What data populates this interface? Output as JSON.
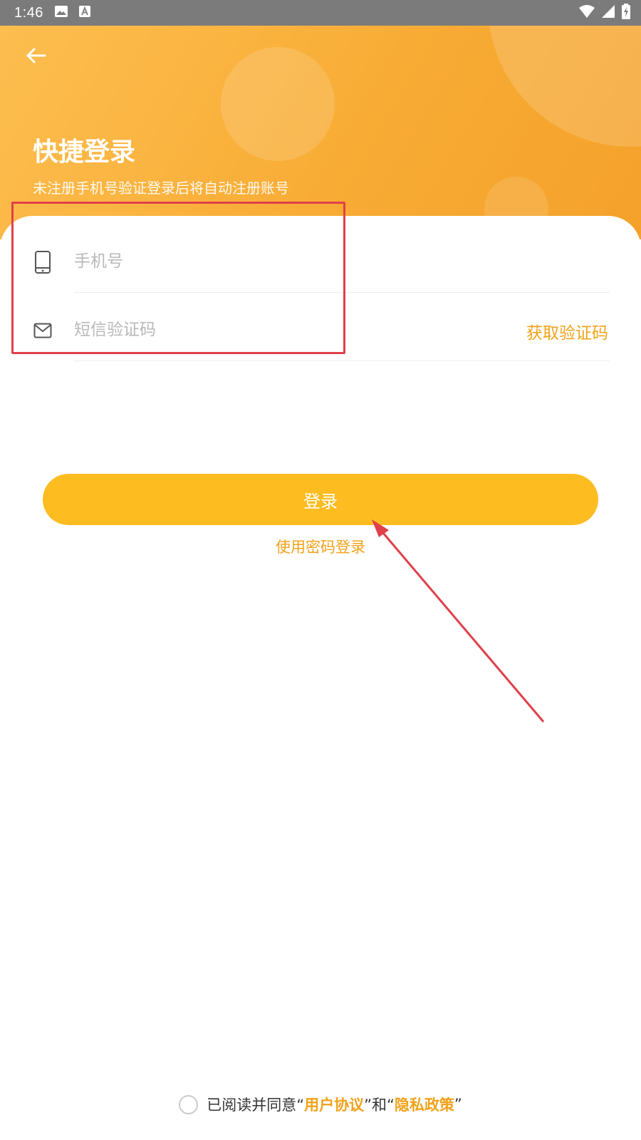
{
  "status_bar": {
    "time": "1:46",
    "icons": [
      "image-icon",
      "a-letter-icon",
      "wifi-icon",
      "signal-icon",
      "battery-icon"
    ]
  },
  "header": {
    "back_icon": "arrow-left-icon",
    "title": "快捷登录",
    "subtitle": "未注册手机号验证登录后将自动注册账号"
  },
  "form": {
    "phone": {
      "icon": "phone-icon",
      "placeholder": "手机号",
      "value": ""
    },
    "sms": {
      "icon": "mail-icon",
      "placeholder": "短信验证码",
      "value": "",
      "get_code_label": "获取验证码"
    }
  },
  "actions": {
    "login_label": "登录",
    "password_login_label": "使用密码登录"
  },
  "agreement": {
    "prefix": "已阅读并同意“",
    "user_agreement": "用户协议",
    "middle": "”和“",
    "privacy_policy": "隐私政策",
    "suffix": "”"
  },
  "colors": {
    "header_gradient_start": "#fdbe4f",
    "header_gradient_end": "#f4a12a",
    "accent": "#f0a21a",
    "button": "#fdbd21",
    "annotation": "#e0404a"
  }
}
